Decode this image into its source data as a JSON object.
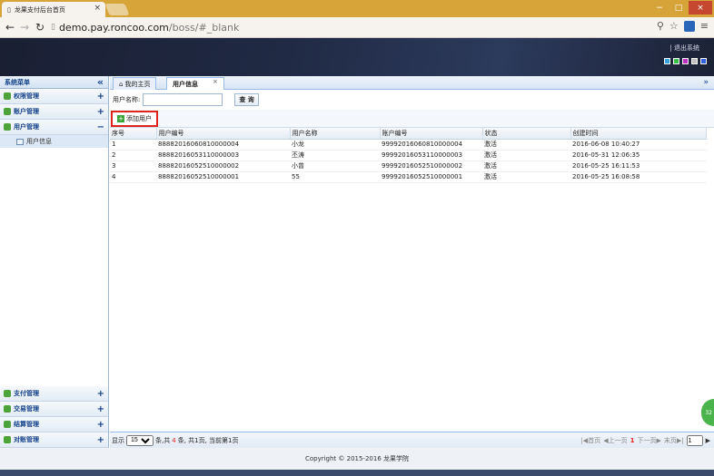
{
  "browser": {
    "tab_title": "龙果支付后台首页",
    "url_host": "demo.pay.roncoo.com",
    "url_path": "/boss/#_blank",
    "window_buttons": [
      "−",
      "□",
      "×"
    ]
  },
  "header": {
    "logout_label": "| 退出系统",
    "theme_colors": [
      "#3aa0e0",
      "#3ac04a",
      "#c030c0",
      "#c0c0c0",
      "#3060e0"
    ]
  },
  "sidebar": {
    "title": "系统菜单",
    "collapse_icon": "«",
    "top_items": [
      {
        "label": "权限管理",
        "toggle": "+"
      },
      {
        "label": "账户管理",
        "toggle": "+"
      },
      {
        "label": "用户管理",
        "toggle": "−"
      }
    ],
    "sub_items": [
      {
        "label": "用户信息"
      }
    ],
    "bottom_items": [
      {
        "label": "支付管理",
        "toggle": "+"
      },
      {
        "label": "交易管理",
        "toggle": "+"
      },
      {
        "label": "结算管理",
        "toggle": "+"
      },
      {
        "label": "对账管理",
        "toggle": "+"
      }
    ]
  },
  "main": {
    "tabs": [
      {
        "label": "我的主页"
      },
      {
        "label": "用户信息",
        "close": "×"
      }
    ],
    "search": {
      "label": "用户名称:",
      "value": "",
      "button": "查 询"
    },
    "add_button": "添加用户",
    "table": {
      "headers": [
        "序号",
        "用户编号",
        "用户名称",
        "账户编号",
        "状态",
        "创建时间"
      ],
      "rows": [
        [
          "1",
          "88882016060810000004",
          "小龙",
          "99992016060810000004",
          "激活",
          "2016-06-08 10:40:27"
        ],
        [
          "2",
          "88882016053110000003",
          "丕涛",
          "99992016053110000003",
          "激活",
          "2016-05-31 12:06:35"
        ],
        [
          "3",
          "88882016052510000002",
          "小曾",
          "99992016052510000002",
          "激活",
          "2016-05-25 16:11:53"
        ],
        [
          "4",
          "88882016052510000001",
          "55",
          "99992016052510000001",
          "激活",
          "2016-05-25 16:08:58"
        ]
      ]
    },
    "pager": {
      "show_label": "显示",
      "page_size": "15",
      "summary_prefix": "条,共",
      "summary_count": "4",
      "summary_suffix": "条, 共1页, 当前第1页",
      "first": "|◀首页",
      "prev": "◀上一页",
      "current": "1",
      "next": "下一页▶",
      "last": "末页▶|",
      "goto_value": "1",
      "goto_icon": "▶"
    }
  },
  "footer": {
    "copyright": "Copyright © 2015-2016 龙果学院"
  },
  "badge": {
    "text": "32"
  }
}
